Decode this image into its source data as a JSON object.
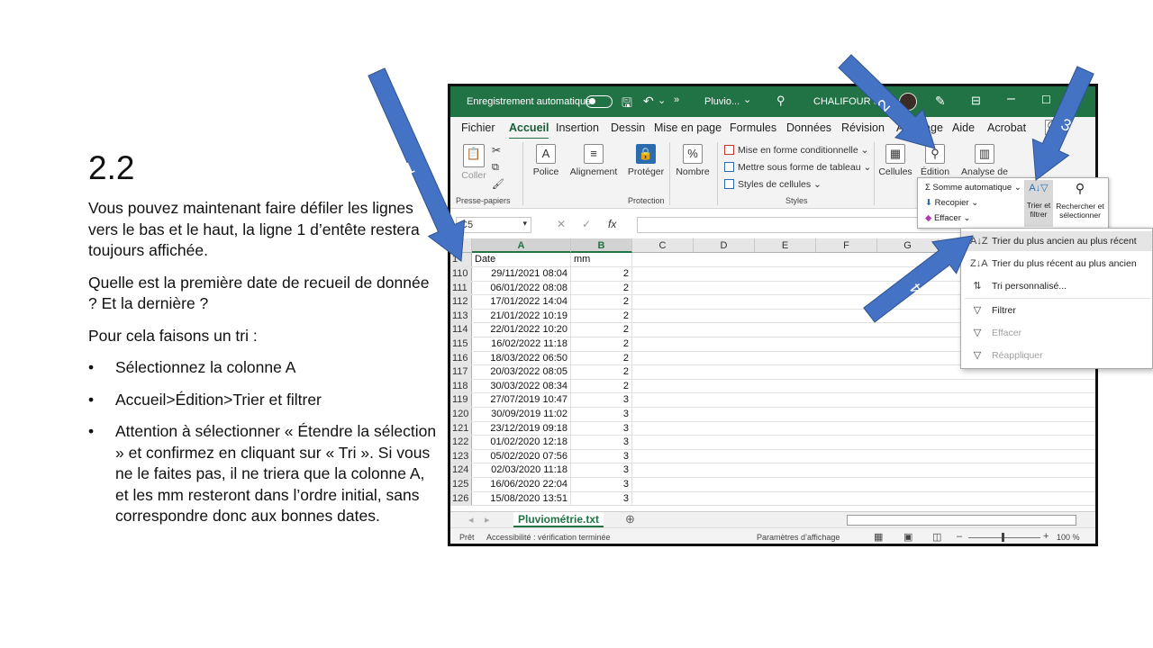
{
  "slide": {
    "title": "2.2",
    "paragraphs": [
      "Vous pouvez maintenant faire défiler les lignes vers le bas et le haut, la ligne 1 d’entête restera toujours affichée.",
      "Quelle est la première date de recueil de donnée  ? Et la dernière  ?",
      "Pour cela faisons un tri :"
    ],
    "bullets": [
      "Sélectionnez la colonne A",
      "Accueil>Édition>Trier  et filtrer",
      "Attention à sélectionner « Étendre la sélection » et confirmez en cliquant sur « Tri ». Si vous ne le faites pas, il ne triera que la colonne A, et les mm resteront dans l’ordre initial, sans correspondre donc aux bonnes dates."
    ]
  },
  "excel": {
    "titlebar": {
      "autosave": "Enregistrement automatique",
      "filename": "Pluvio...",
      "user": "CHALIFOUR Sa"
    },
    "menu": [
      "Fichier",
      "Accueil",
      "Insertion",
      "Dessin",
      "Mise en page",
      "Formules",
      "Données",
      "Révision",
      "Affichage",
      "Aide",
      "Acrobat"
    ],
    "ribbon": {
      "coller": "Coller",
      "presse_papiers": "Presse-papiers",
      "police": "Police",
      "alignement": "Alignement",
      "proteger": "Protéger",
      "protection": "Protection",
      "nombre": "Nombre",
      "mise_en_forme": "Mise en forme conditionnelle",
      "tableau": "Mettre sous forme de tableau",
      "styles_cellules": "Styles de cellules",
      "styles": "Styles",
      "cellules": "Cellules",
      "edition": "Édition",
      "analyse": "Analyse de"
    },
    "edit_panel": {
      "somme": "Somme automatique",
      "recopier": "Recopier",
      "effacer": "Effacer",
      "trier_1": "Trier et",
      "trier_2": "filtrer",
      "rechercher_1": "Rechercher et",
      "rechercher_2": "sélectionner"
    },
    "namebox": "C5",
    "fx": "fx",
    "columns": [
      "A",
      "B",
      "C",
      "D",
      "E",
      "F",
      "G"
    ],
    "header_row": {
      "num": "1",
      "a": "Date",
      "b": "mm"
    },
    "rows": [
      {
        "num": "110",
        "a": "29/11/2021 08:04",
        "b": "2"
      },
      {
        "num": "111",
        "a": "06/01/2022 08:08",
        "b": "2"
      },
      {
        "num": "112",
        "a": "17/01/2022 14:04",
        "b": "2"
      },
      {
        "num": "113",
        "a": "21/01/2022 10:19",
        "b": "2"
      },
      {
        "num": "114",
        "a": "22/01/2022 10:20",
        "b": "2"
      },
      {
        "num": "115",
        "a": "16/02/2022 11:18",
        "b": "2"
      },
      {
        "num": "116",
        "a": "18/03/2022 06:50",
        "b": "2"
      },
      {
        "num": "117",
        "a": "20/03/2022 08:05",
        "b": "2"
      },
      {
        "num": "118",
        "a": "30/03/2022 08:34",
        "b": "2"
      },
      {
        "num": "119",
        "a": "27/07/2019 10:47",
        "b": "3"
      },
      {
        "num": "120",
        "a": "30/09/2019 11:02",
        "b": "3"
      },
      {
        "num": "121",
        "a": "23/12/2019 09:18",
        "b": "3"
      },
      {
        "num": "122",
        "a": "01/02/2020 12:18",
        "b": "3"
      },
      {
        "num": "123",
        "a": "05/02/2020 07:56",
        "b": "3"
      },
      {
        "num": "124",
        "a": "02/03/2020 11:18",
        "b": "3"
      },
      {
        "num": "125",
        "a": "16/06/2020 22:04",
        "b": "3"
      },
      {
        "num": "126",
        "a": "15/08/2020 13:51",
        "b": "3"
      }
    ],
    "sheet_tab": "Pluviométrie.txt",
    "status": {
      "ready": "Prêt",
      "accessibility": "Accessibilité : vérification terminée",
      "display_settings": "Paramètres d’affichage",
      "zoom": "100 %"
    },
    "sort_menu": [
      {
        "label": "Trier du plus ancien au plus récent",
        "icon": "sort-ascending-icon",
        "glyph": "A↓Z",
        "hover": true,
        "disabled": false
      },
      {
        "label": "Trier du plus récent au plus ancien",
        "icon": "sort-descending-icon",
        "glyph": "Z↓A",
        "hover": false,
        "disabled": false
      },
      {
        "label": "Tri personnalisé...",
        "icon": "custom-sort-icon",
        "glyph": "⇅",
        "hover": false,
        "disabled": false
      },
      {
        "label": "Filtrer",
        "icon": "filter-icon",
        "glyph": "▽",
        "hover": false,
        "disabled": false
      },
      {
        "label": "Effacer",
        "icon": "clear-filter-icon",
        "glyph": "▽",
        "hover": false,
        "disabled": true
      },
      {
        "label": "Réappliquer",
        "icon": "reapply-icon",
        "glyph": "▽",
        "hover": false,
        "disabled": true
      }
    ]
  },
  "arrows": {
    "color": "#4472c4",
    "labels": [
      "1",
      "2",
      "3",
      "4"
    ]
  }
}
